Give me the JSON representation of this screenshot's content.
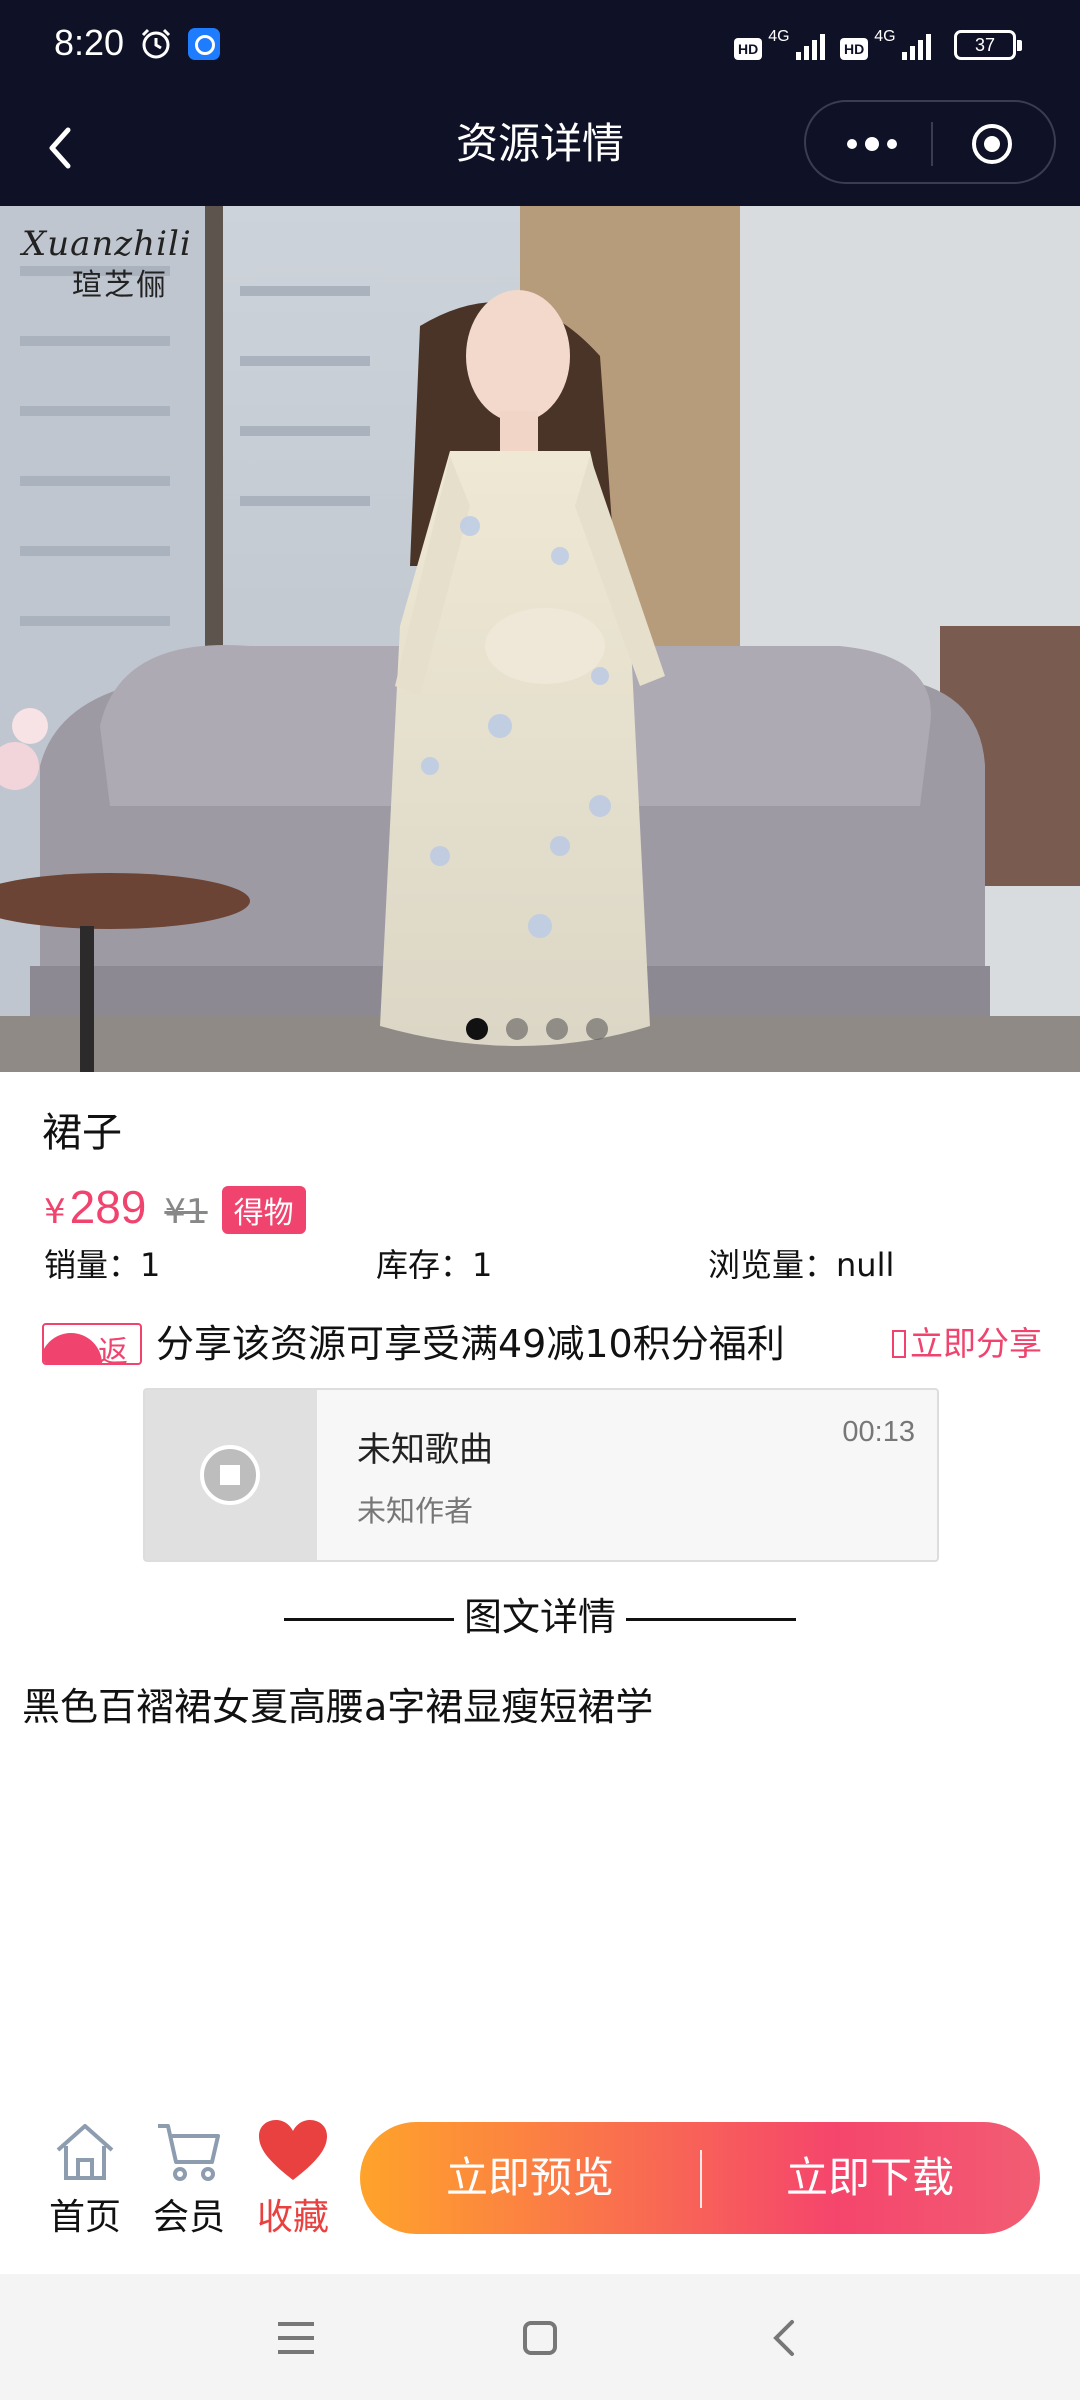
{
  "status_bar": {
    "time": "8:20",
    "network1": "4G",
    "network2": "4G",
    "hd_label": "HD",
    "battery": "37"
  },
  "nav": {
    "title": "资源详情"
  },
  "hero": {
    "brand_script": "Xuanzhili",
    "brand_cn": "瑄芝俪",
    "slide_count": 4,
    "active_slide": 1
  },
  "product": {
    "title": "裙子",
    "currency": "¥",
    "price": "289",
    "original_price": "¥1",
    "tag": "得物",
    "sales_label": "销量：1",
    "stock_label": "库存：1",
    "views_label": "浏览量：null"
  },
  "share": {
    "badge": "返",
    "text": "分享该资源可享受满49减10积分福利",
    "action": "立即分享"
  },
  "player": {
    "song": "未知歌曲",
    "author": "未知作者",
    "duration": "00:13"
  },
  "details": {
    "heading": "图文详情",
    "description": "黑色百褶裙女夏高腰a字裙显瘦短裙学"
  },
  "bottom_bar": {
    "home": "首页",
    "member": "会员",
    "favorite": "收藏",
    "preview": "立即预览",
    "download": "立即下载"
  },
  "colors": {
    "accent": "#f0436d",
    "header_bg": "#0f1126",
    "cta_start": "#ffa32a",
    "cta_end": "#f25d73"
  }
}
